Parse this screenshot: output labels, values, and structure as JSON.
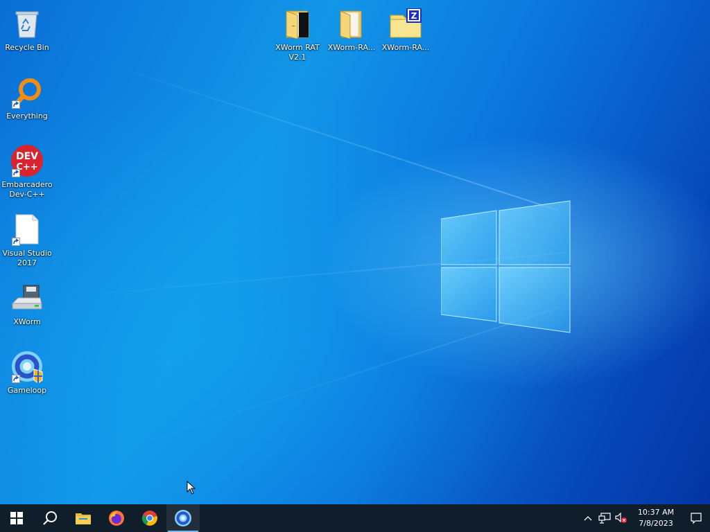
{
  "desktop": {
    "left_icons": [
      {
        "label": "Recycle Bin",
        "icon": "recycle-bin-icon"
      },
      {
        "label": "Everything",
        "icon": "everything-icon",
        "shortcut": true
      },
      {
        "label": "Embarcadero\nDev-C++",
        "icon": "dev-cpp-icon",
        "shortcut": true
      },
      {
        "label": "Visual Studio\n2017",
        "icon": "file-icon",
        "shortcut": true
      },
      {
        "label": "XWorm",
        "icon": "drive-icon"
      },
      {
        "label": "Gameloop",
        "icon": "gameloop-icon",
        "shortcut": true
      }
    ],
    "top_icons": [
      {
        "label": "XWorm RAT\nV2.1",
        "icon": "folder-icon"
      },
      {
        "label": "XWorm-RA...",
        "icon": "folder-icon"
      },
      {
        "label": "XWorm-RA...",
        "icon": "zip-archive-icon"
      }
    ]
  },
  "taskbar": {
    "apps": [
      {
        "name": "start",
        "icon": "windows-start-icon"
      },
      {
        "name": "search",
        "icon": "search-icon"
      },
      {
        "name": "file-explorer",
        "icon": "file-explorer-icon"
      },
      {
        "name": "firefox",
        "icon": "firefox-icon"
      },
      {
        "name": "chrome",
        "icon": "chrome-icon"
      },
      {
        "name": "gameloop",
        "icon": "gameloop-icon",
        "active": true
      }
    ],
    "clock": {
      "time": "10:37 AM",
      "date": "7/8/2023"
    }
  },
  "colors": {
    "taskbar": "#101d2b",
    "accent": "#76b9ed"
  }
}
